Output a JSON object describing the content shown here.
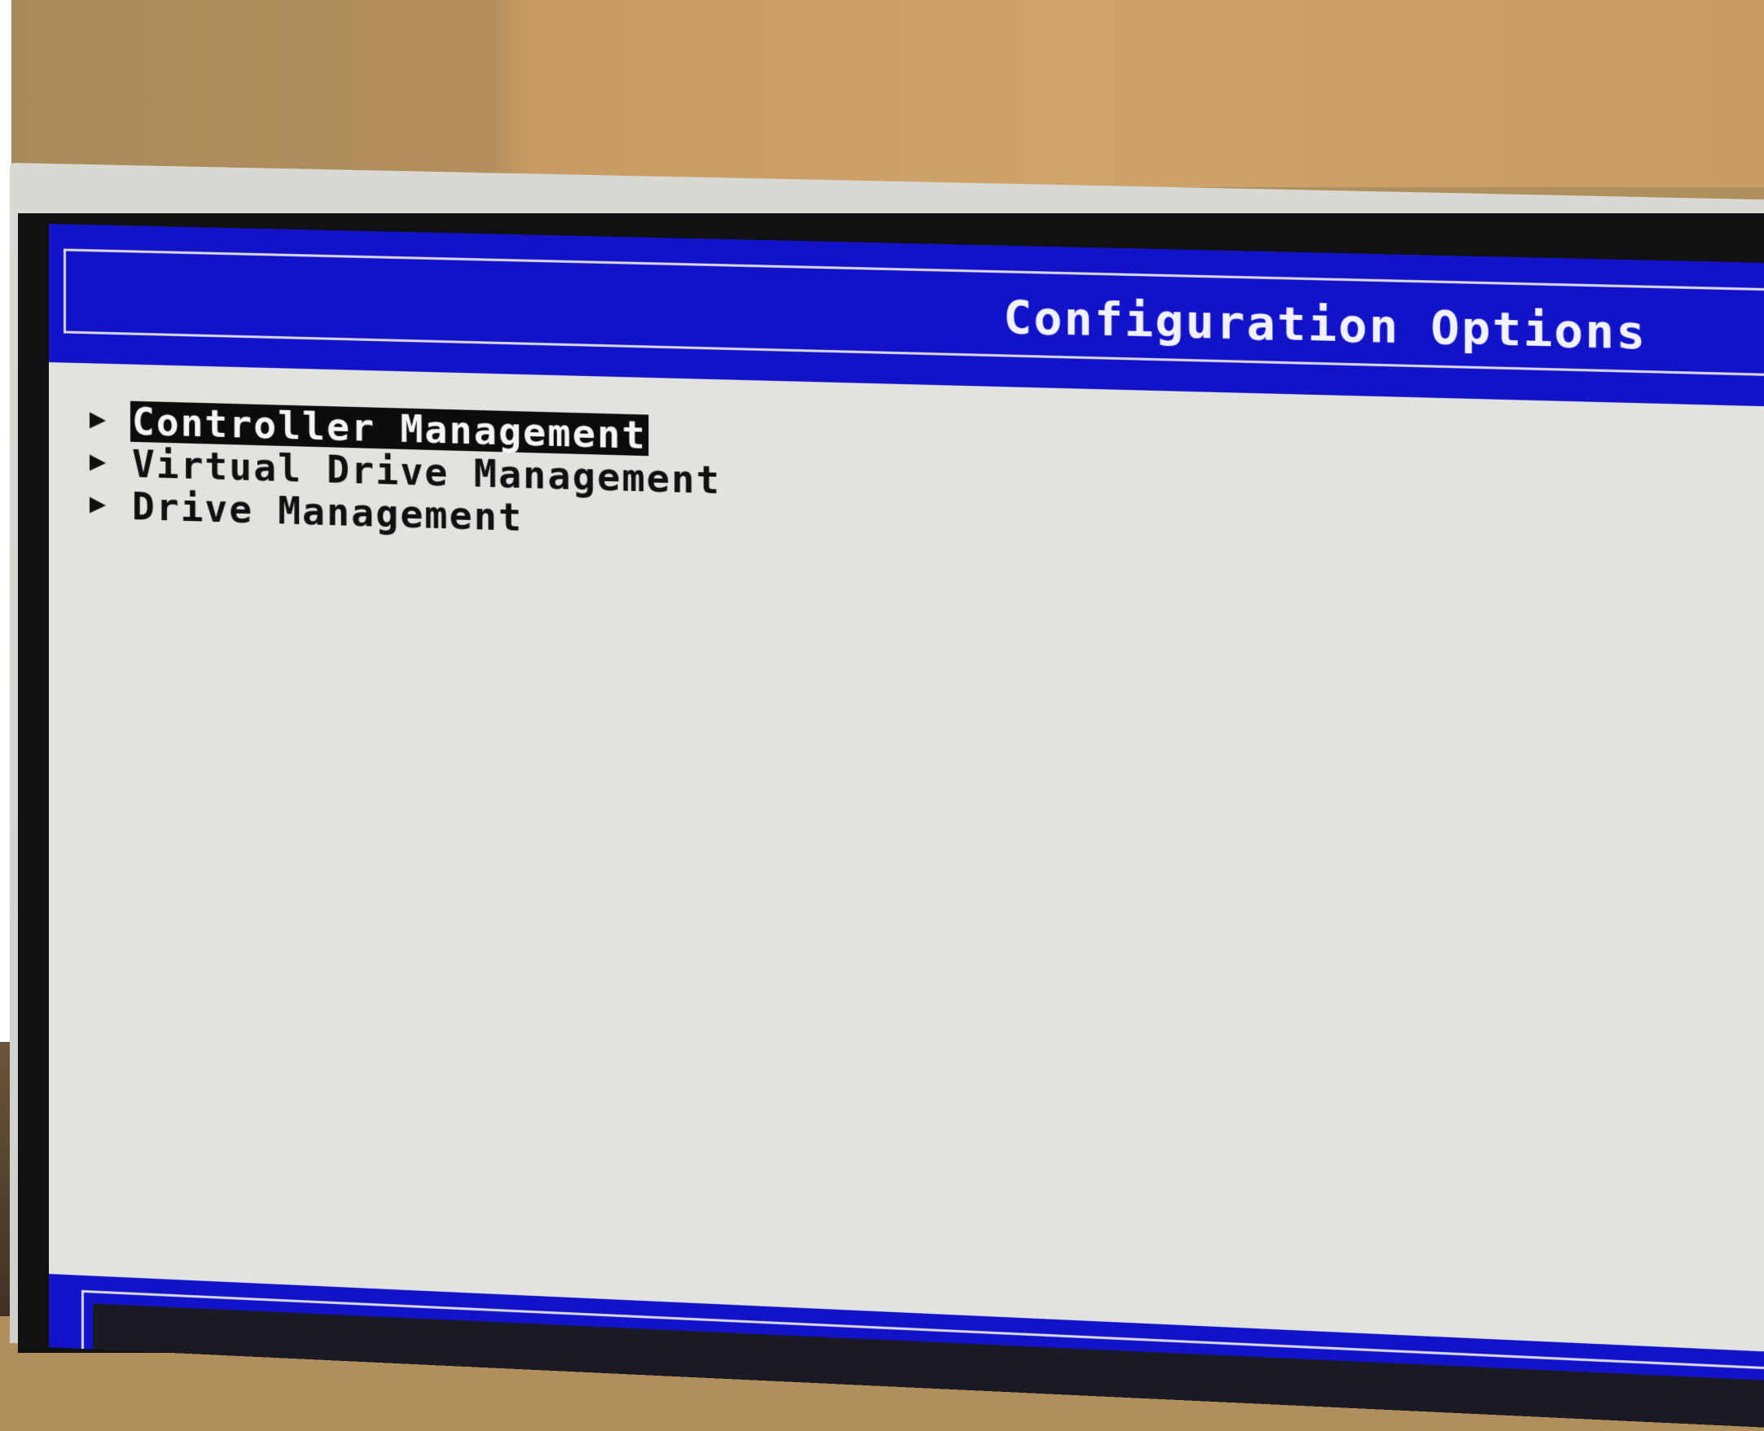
{
  "screen": {
    "title": "Configuration Options",
    "menu": [
      {
        "label": "Controller Management",
        "selected": true
      },
      {
        "label": "Virtual Drive Management",
        "selected": false
      },
      {
        "label": "Drive Management",
        "selected": false
      }
    ],
    "colors": {
      "header_bg": "#1212c8",
      "screen_bg": "#e2e3df",
      "selected_bg": "#0c0c0c",
      "title_text": "#f2f2ff"
    },
    "icons": {
      "menu_arrow": "triangle-right-icon"
    }
  }
}
